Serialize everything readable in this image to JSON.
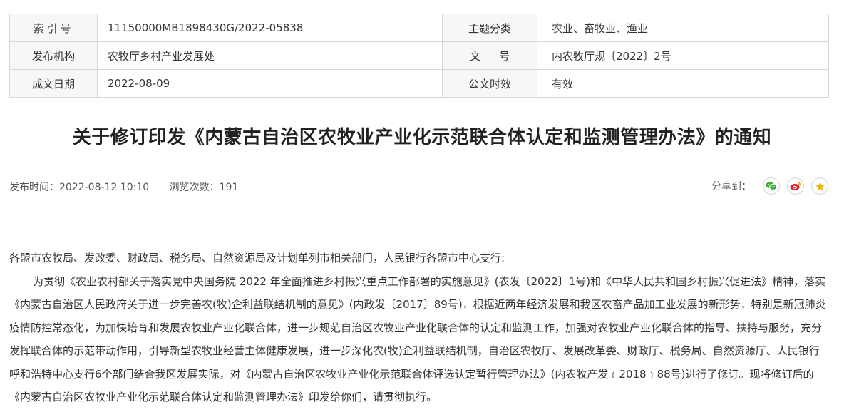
{
  "meta": {
    "rows": [
      {
        "k1": "索引号",
        "v1": "11150000MB1898430G/2022-05838",
        "k2": "主题分类",
        "v2": "农业、畜牧业、渔业"
      },
      {
        "k1": "发布机构",
        "v1": "农牧厅乡村产业发展处",
        "k2": "文号",
        "v2": "内农牧厅规〔2022〕2号"
      },
      {
        "k1": "成文日期",
        "v1": "2022-08-09",
        "k2": "公文时效",
        "v2": "有效"
      }
    ]
  },
  "article": {
    "title": "关于修订印发《内蒙古自治区农牧业产业化示范联合体认定和监测管理办法》的通知",
    "publish_time": "发布时间：2022-08-12 10:10",
    "views": "浏览次数：191",
    "share_label": "分享到：",
    "salutation": "各盟市农牧局、发改委、财政局、税务局、自然资源局及计划单列市相关部门，人民银行各盟市中心支行:",
    "body": "为贯彻《农业农村部关于落实党中央国务院 2022 年全面推进乡村振兴重点工作部署的实施意见》(农发〔2022〕1号)和《中华人民共和国乡村振兴促进法》精神，落实《内蒙古自治区人民政府关于进一步完善农(牧)企利益联结机制的意见》(内政发〔2017〕89号)，根据近两年经济发展和我区农畜产品加工业发展的新形势，特别是新冠肺炎疫情防控常态化，为加快培育和发展农牧业产业化联合体，进一步规范自治区农牧业产业化联合体的认定和监测工作，加强对农牧业产业化联合体的指导、扶持与服务，充分发挥联合体的示范带动作用，引导新型农牧业经营主体健康发展，进一步深化农(牧)企利益联结机制，自治区农牧厅、发展改革委、财政厅、税务局、自然资源厅、人民银行呼和浩特中心支行6个部门结合我区发展实际，对《内蒙古自治区农牧业产业化示范联合体评选认定暂行管理办法》(内农牧产发﹝2018﹞88号)进行了修订。现将修订后的《内蒙古自治区农牧业产业化示范联合体认定和监测管理办法》印发给你们，请贯彻执行。"
  },
  "share_icons": [
    "wechat-icon",
    "weibo-icon",
    "favorite-star-icon"
  ],
  "colors": {
    "wechat": "#3cb034",
    "weibo": "#e6162d",
    "star": "#f0b400"
  }
}
